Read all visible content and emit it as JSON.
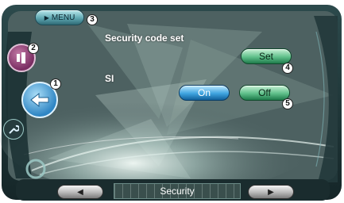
{
  "header": {
    "menu_label": "MENU",
    "menu_icon": "play-triangle-icon"
  },
  "content": {
    "security_code_label": "Security code set",
    "set_button_label": "Set",
    "si_label": "SI",
    "on_button_label": "On",
    "off_button_label": "Off",
    "si_selected": "On"
  },
  "callouts": [
    "1",
    "2",
    "3",
    "4",
    "5"
  ],
  "footer": {
    "prev_icon": "arrow-left-icon",
    "next_icon": "arrow-right-icon",
    "status_text": "Security"
  },
  "colors": {
    "frame": "#1e3436",
    "panel": "#4e6262",
    "accent_green": "#5fc08a",
    "accent_blue": "#3fa4e0"
  }
}
